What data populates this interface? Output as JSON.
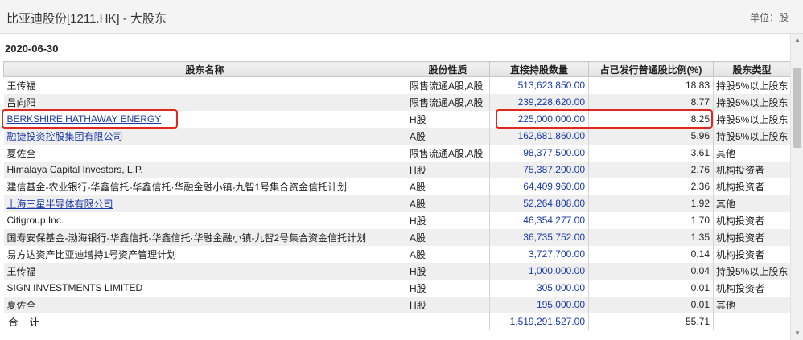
{
  "header": {
    "title": "比亚迪股份[1211.HK] - 大股东",
    "unit": "单位：股"
  },
  "report": {
    "date": "2020-06-30"
  },
  "table": {
    "columns": [
      "股东名称",
      "股份性质",
      "直接持股数量",
      "占已发行普通股比例(%)",
      "股东类型"
    ],
    "rows": [
      {
        "name": "王传福",
        "nature": "限售流通A股,A股",
        "shares": "513,623,850.00",
        "pct": "18.83",
        "type": "持股5%以上股东",
        "link": false
      },
      {
        "name": "吕向阳",
        "nature": "限售流通A股,A股",
        "shares": "239,228,620.00",
        "pct": "8.77",
        "type": "持股5%以上股东",
        "link": false
      },
      {
        "name": "BERKSHIRE HATHAWAY ENERGY",
        "nature": "H股",
        "shares": "225,000,000.00",
        "pct": "8.25",
        "type": "持股5%以上股东",
        "link": true
      },
      {
        "name": "融捷投资控股集团有限公司",
        "nature": "A股",
        "shares": "162,681,860.00",
        "pct": "5.96",
        "type": "持股5%以上股东",
        "link": true
      },
      {
        "name": "夏佐全",
        "nature": "限售流通A股,A股",
        "shares": "98,377,500.00",
        "pct": "3.61",
        "type": "其他",
        "link": false
      },
      {
        "name": "Himalaya Capital Investors, L.P.",
        "nature": "H股",
        "shares": "75,387,200.00",
        "pct": "2.76",
        "type": "机构投资者",
        "link": false
      },
      {
        "name": "建信基金-农业银行-华鑫信托-华鑫信托·华融金融小镇-九智1号集合资金信托计划",
        "nature": "A股",
        "shares": "64,409,960.00",
        "pct": "2.36",
        "type": "机构投资者",
        "link": false
      },
      {
        "name": "上海三星半导体有限公司",
        "nature": "A股",
        "shares": "52,264,808.00",
        "pct": "1.92",
        "type": "其他",
        "link": true
      },
      {
        "name": "Citigroup Inc.",
        "nature": "H股",
        "shares": "46,354,277.00",
        "pct": "1.70",
        "type": "机构投资者",
        "link": false
      },
      {
        "name": "国寿安保基金-渤海银行-华鑫信托-华鑫信托·华融金融小镇-九智2号集合资金信托计划",
        "nature": "A股",
        "shares": "36,735,752.00",
        "pct": "1.35",
        "type": "机构投资者",
        "link": false
      },
      {
        "name": "易方达资产比亚迪增持1号资产管理计划",
        "nature": "A股",
        "shares": "3,727,700.00",
        "pct": "0.14",
        "type": "机构投资者",
        "link": false
      },
      {
        "name": "王传福",
        "nature": "H股",
        "shares": "1,000,000.00",
        "pct": "0.04",
        "type": "持股5%以上股东",
        "link": false
      },
      {
        "name": "SIGN INVESTMENTS LIMITED",
        "nature": "H股",
        "shares": "305,000.00",
        "pct": "0.01",
        "type": "机构投资者",
        "link": false
      },
      {
        "name": "夏佐全",
        "nature": "H股",
        "shares": "195,000.00",
        "pct": "0.01",
        "type": "其他",
        "link": false
      }
    ],
    "total": {
      "label": "合计",
      "shares": "1,519,291,527.00",
      "pct": "55.71"
    }
  },
  "colors": {
    "highlight": "#e0281e",
    "link": "#1a3aa8"
  }
}
